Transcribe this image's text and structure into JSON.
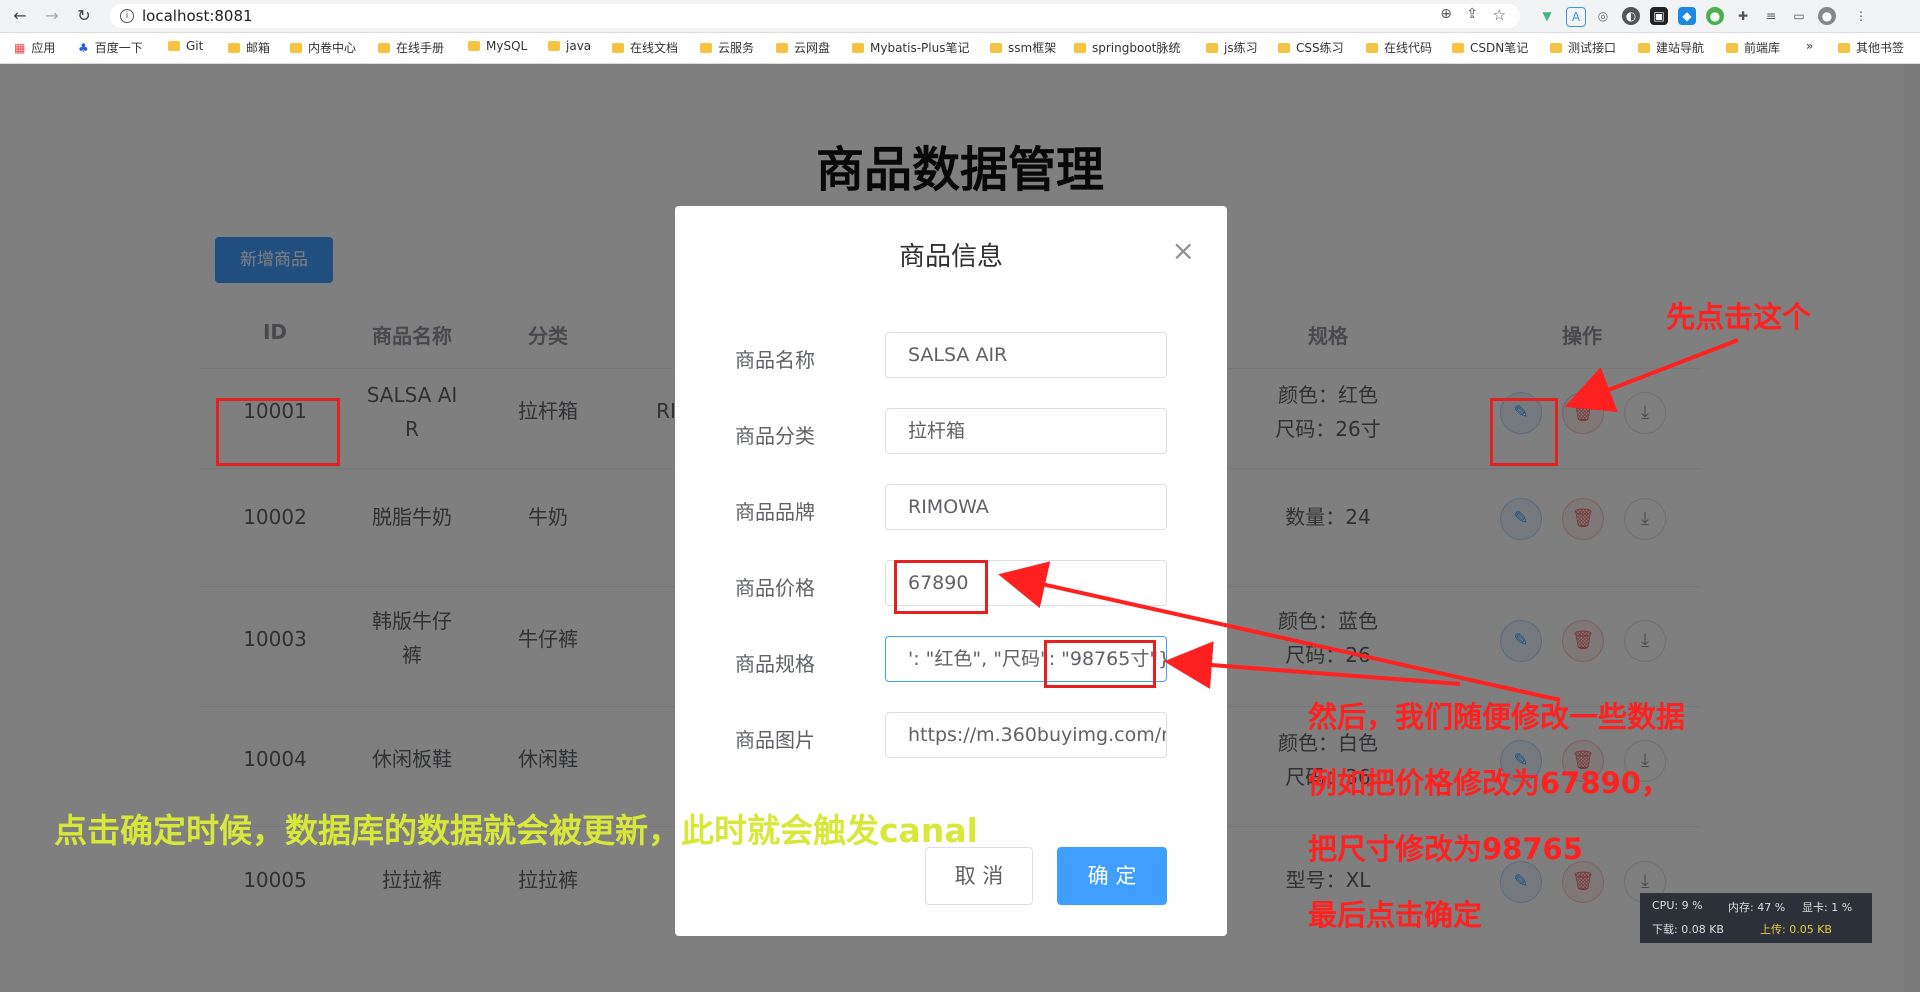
{
  "browser": {
    "url": "localhost:8081",
    "bookmarks": [
      "应用",
      "百度一下",
      "Git",
      "邮箱",
      "内卷中心",
      "在线手册",
      "MySQL",
      "java",
      "在线文档",
      "云服务",
      "云网盘",
      "Mybatis-Plus笔记",
      "ssm框架",
      "springboot脉统",
      "js练习",
      "CSS练习",
      "在线代码",
      "CSDN笔记",
      "测试接口",
      "建站导航",
      "前端库",
      "其他书签"
    ],
    "more_bookmarks": "»"
  },
  "page": {
    "title": "商品数据管理",
    "add_button": "新增商品",
    "table": {
      "headers": {
        "id": "ID",
        "name": "商品名称",
        "category": "分类",
        "spec": "规格",
        "actions": "操作"
      },
      "rows": [
        {
          "id": "10001",
          "name_line1": "SALSA AI",
          "name_line2": "R",
          "category": "拉杆箱",
          "brand_partial": "RI",
          "spec_line1": "颜色：红色",
          "spec_line2": "尺码：26寸"
        },
        {
          "id": "10002",
          "name_line1": "脱脂牛奶",
          "name_line2": "",
          "category": "牛奶",
          "spec_line1": "数量：24",
          "spec_line2": ""
        },
        {
          "id": "10003",
          "name_line1": "韩版牛仔",
          "name_line2": "裤",
          "category": "牛仔裤",
          "spec_line1": "颜色：蓝色",
          "spec_line2": "尺码：26"
        },
        {
          "id": "10004",
          "name_line1": "休闲板鞋",
          "name_line2": "",
          "category": "休闲鞋",
          "spec_line1": "颜色：白色",
          "spec_line2": "尺码：36"
        },
        {
          "id": "10005",
          "name_line1": "拉拉裤",
          "name_line2": "",
          "category": "拉拉裤",
          "spec_line1": "型号：XL",
          "spec_line2": ""
        }
      ]
    }
  },
  "dialog": {
    "title": "商品信息",
    "close": "×",
    "fields": [
      {
        "label": "商品名称",
        "value": "SALSA AIR"
      },
      {
        "label": "商品分类",
        "value": "拉杆箱"
      },
      {
        "label": "商品品牌",
        "value": "RIMOWA"
      },
      {
        "label": "商品价格",
        "value": "67890"
      },
      {
        "label": "商品规格",
        "value": "': \"红色\", \"尺码\": \"98765寸\"}"
      },
      {
        "label": "商品图片",
        "value": "https://m.360buyimg.com/m"
      }
    ],
    "cancel_label": "取 消",
    "ok_label": "确 定"
  },
  "annotations": {
    "step1": "先点击这个",
    "step2_line1": "然后，我们随便修改一些数据",
    "step2_line2": "例如把价格修改为67890，",
    "step2_line3": "把尺寸修改为98765",
    "step2_line4": "最后点击确定",
    "bottom_note": "点击确定时候，数据库的数据就会被更新，此时就会触发canal",
    "red_color": "#ff2020",
    "yellow_color": "#d8e83a"
  },
  "system_monitor": {
    "cpu": "CPU: 9 %",
    "mem": "内存: 47 %",
    "gpu": "显卡: 1 %",
    "down": "下载: 0.08 KB",
    "up": "上传: 0.05 KB"
  }
}
